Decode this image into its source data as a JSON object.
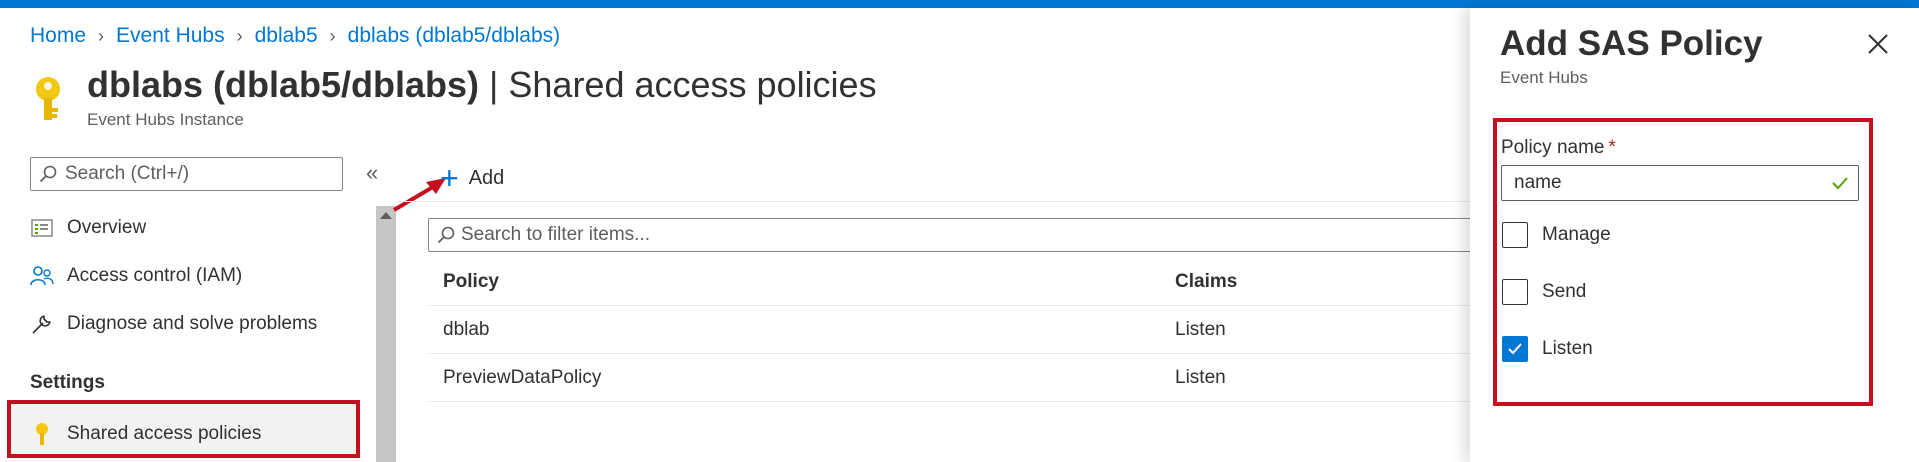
{
  "breadcrumb": [
    "Home",
    "Event Hubs",
    "dblab5",
    "dblabs (dblab5/dblabs)"
  ],
  "page": {
    "title_strong": "dblabs (dblab5/dblabs)",
    "title_rest": " | Shared access policies",
    "subtitle": "Event Hubs Instance"
  },
  "sidebar": {
    "search_placeholder": "Search (Ctrl+/)",
    "collapse": "«",
    "items": [
      {
        "label": "Overview",
        "icon": "overview-icon"
      },
      {
        "label": "Access control (IAM)",
        "icon": "people-icon"
      },
      {
        "label": "Diagnose and solve problems",
        "icon": "wrench-icon"
      }
    ],
    "section": "Settings",
    "active_item": {
      "label": "Shared access policies",
      "icon": "key-icon"
    }
  },
  "toolbar": {
    "add_label": "Add"
  },
  "filter": {
    "placeholder": "Search to filter items..."
  },
  "table": {
    "columns": [
      "Policy",
      "Claims"
    ],
    "rows": [
      {
        "policy": "dblab",
        "claims": "Listen"
      },
      {
        "policy": "PreviewDataPolicy",
        "claims": "Listen"
      }
    ]
  },
  "panel": {
    "title": "Add SAS Policy",
    "subtitle": "Event Hubs",
    "policy_label": "Policy name",
    "required_mark": "*",
    "policy_value": "name",
    "checkboxes": [
      {
        "label": "Manage",
        "checked": false
      },
      {
        "label": "Send",
        "checked": false
      },
      {
        "label": "Listen",
        "checked": true
      }
    ]
  },
  "colors": {
    "accent": "#0078d4",
    "highlight": "#c50f1f",
    "key": "#f2c811"
  }
}
